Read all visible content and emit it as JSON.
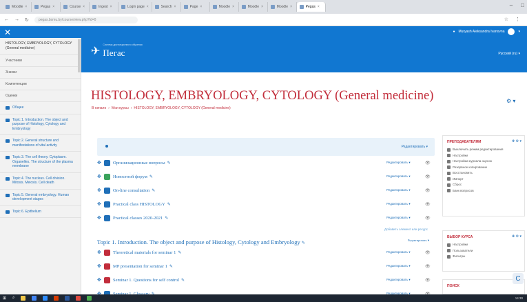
{
  "browser": {
    "tabs": [
      "Moodle",
      "Pegas",
      "Course",
      "Ingest",
      "Login page",
      "Search",
      "Page",
      "Moodle",
      "Moodle",
      "Moodle",
      "Pegas"
    ],
    "url": "pegas.bsmu.by/course/view.php?id=0"
  },
  "topnav": {
    "close_icon": "close-icon",
    "user_name": "Muryash Aleksandra Ivanovna"
  },
  "drawer": {
    "course_short": "HISTOLOGY, EMBRYOLOGY, CYTOLOGY (General medicine)",
    "items": [
      "Участники",
      "Значки",
      "Компетенции",
      "Оценки"
    ],
    "topics": [
      "Общее",
      "Topic 1. Introduction. The object and purpose of Histology, Cytology and Embryology",
      "Topic 2. General structure and manifestations of vital activity",
      "Topic 3. The cell theory. Cytoplasm. Organelles. The structure of the plasma membrane",
      "Topic 4. The nucleus. Cell division. Mitosis. Meiosis. Cell death",
      "Topic 5. General embryology. Human development stages",
      "Topic 6. Epithelium"
    ]
  },
  "header": {
    "logo_name": "Пегас",
    "logo_small": "Система дистанционного обучения",
    "language": "Русский (ru) ▾"
  },
  "page": {
    "title": "HISTOLOGY, EMBRYOLOGY, CYTOLOGY (General medicine)",
    "breadcrumb": [
      "В начало",
      "Мои курсы",
      "HISTOLOGY, EMBRYOLOGY, CYTOLOGY (General medicine)"
    ]
  },
  "section0": {
    "edit_label": "Редактировать ▾",
    "activities": [
      {
        "label": "Организационные вопросы",
        "edit": "Редактировать ▾",
        "color": "#1f6fb8"
      },
      {
        "label": "Новостной форум",
        "edit": "Редактировать ▾",
        "color": "#3aa35b"
      },
      {
        "label": "On-line consultation",
        "edit": "Редактировать ▾",
        "color": "#1f6fb8"
      },
      {
        "label": "Practical class HISTOLOGY",
        "edit": "Редактировать ▾",
        "color": "#1f6fb8"
      },
      {
        "label": "Practical classes 2020-2021",
        "edit": "Редактировать ▾",
        "color": "#1f6fb8"
      }
    ],
    "add_label": "Добавить элемент или ресурс"
  },
  "section1": {
    "title": "Topic 1. Introduction. The object and purpose of Histology, Cytology and Embryology",
    "edit_label": "Редактировать ▾",
    "activities": [
      {
        "label": "Theoretical materials for seminar 1",
        "edit": "Редактировать ▾",
        "color": "#c22d3b"
      },
      {
        "label": "MP presentation for seminar 1",
        "edit": "Редактировать ▾",
        "color": "#c22d3b"
      },
      {
        "label": "Seminar 1. Questions for self control",
        "edit": "Редактировать ▾",
        "color": "#c22d3b"
      },
      {
        "label": "Seminar 1. Glossary",
        "edit": "Редактировать ▾",
        "color": "#1f6fb8"
      }
    ]
  },
  "blocks": {
    "teachers": {
      "title": "ПРЕПОДАВАТЕЛЯМ",
      "lines": [
        "Выключить режим редактирования",
        "Настройки",
        "Настройки журнала оценок",
        "Резервное копирование",
        "Восстановить",
        "Импорт",
        "Сброс",
        "Банк вопросов"
      ]
    },
    "select": {
      "title": "ВЫБОР КУРСА",
      "lines": [
        "Настройки",
        "Пользователи",
        "Фильтры"
      ]
    },
    "other": {
      "title": "ПОИСК"
    }
  },
  "taskbar": {
    "clock": "14:30"
  }
}
